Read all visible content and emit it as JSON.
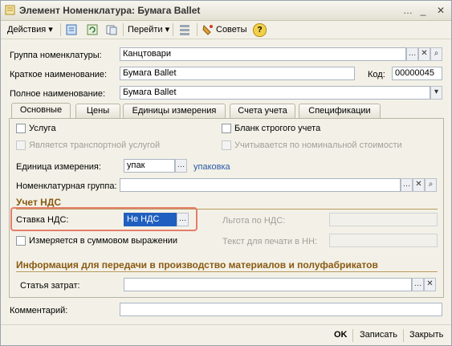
{
  "window": {
    "title": "Элемент Номенклатура: Бумага Ballet"
  },
  "toolbar": {
    "actions_label": "Действия",
    "goto_label": "Перейти",
    "tips_label": "Советы",
    "help_symbol": "?"
  },
  "fields": {
    "group_label": "Группа номенклатуры:",
    "group_value": "Канцтовари",
    "short_name_label": "Краткое наименование:",
    "short_name_value": "Бумага Ballet",
    "code_label": "Код:",
    "code_value": "00000045",
    "full_name_label": "Полное наименование:",
    "full_name_value": "Бумага Ballet"
  },
  "tabs": [
    "Основные",
    "Цены",
    "Единицы измерения",
    "Счета учета",
    "Спецификации"
  ],
  "main": {
    "service_label": "Услуга",
    "strict_blank_label": "Бланк строгого учета",
    "transport_label": "Является транспортной услугой",
    "nominal_label": "Учитывается по номинальной стоимости",
    "unit_label": "Единица измерения:",
    "unit_value": "упак",
    "unit_link": "упаковка",
    "nomen_group_label": "Номенклатурная группа:",
    "nomen_group_value": "",
    "vat_section": "Учет НДС",
    "vat_rate_label": "Ставка НДС:",
    "vat_rate_value": "Не НДС",
    "vat_benefit_label": "Льгота по НДС:",
    "sum_label": "Измеряется в суммовом выражении",
    "print_text_label": "Текст для печати в НН:",
    "production_section": "Информация для передачи в производство материалов и полуфабрикатов",
    "cost_item_label": "Статья затрат:",
    "cost_item_value": ""
  },
  "comment_label": "Комментарий:",
  "comment_value": "",
  "buttons": {
    "ok": "OK",
    "save": "Записать",
    "close": "Закрыть"
  }
}
